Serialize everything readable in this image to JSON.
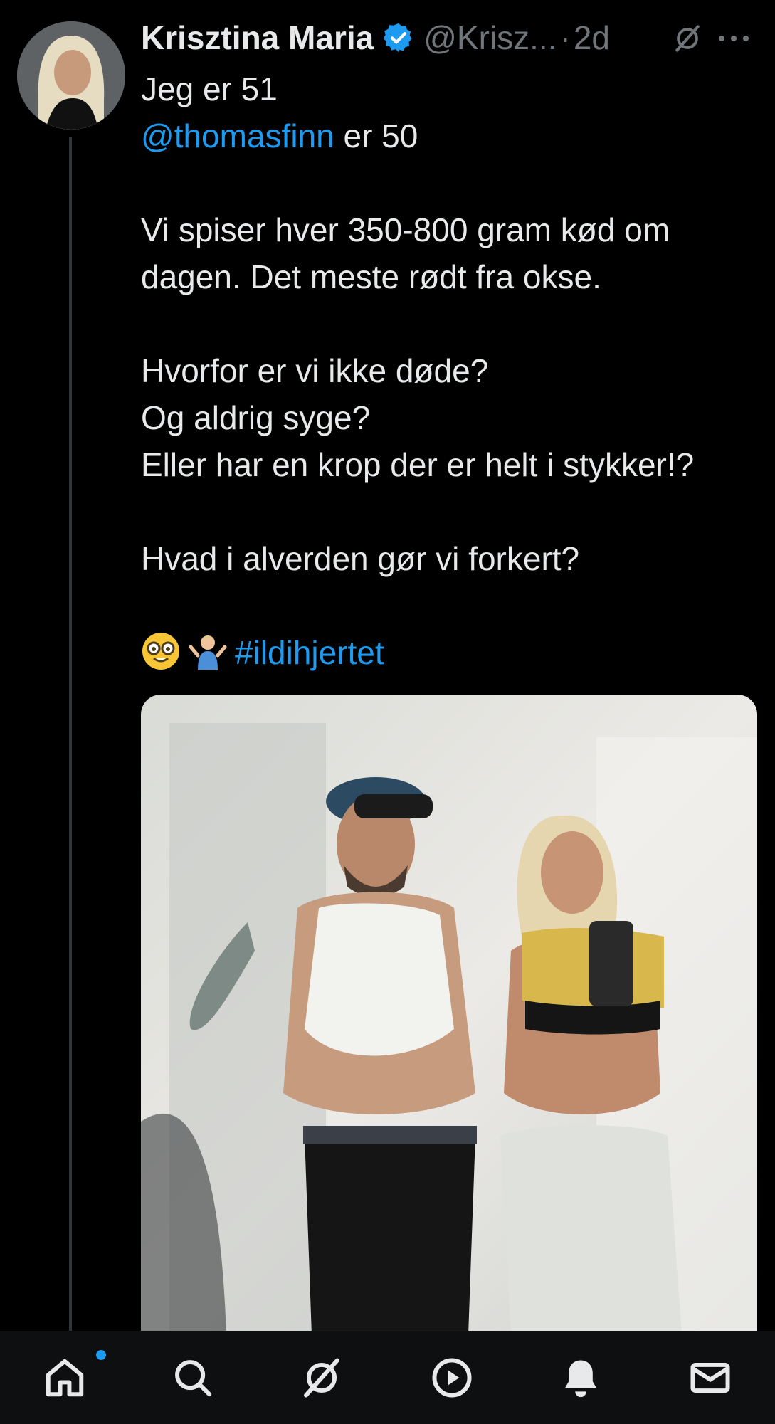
{
  "tweet": {
    "author_name": "Krisztina Maria",
    "handle": "@Krisz...",
    "separator": "·",
    "time": "2d",
    "lines": [
      {
        "text": "Jeg er 51"
      },
      {
        "mention": "@thomasfinn",
        "rest": " er 50"
      },
      {
        "text": ""
      },
      {
        "text": "Vi spiser hver 350-800 gram kød om"
      },
      {
        "text": "dagen. Det meste rødt fra okse."
      },
      {
        "text": ""
      },
      {
        "text": "Hvorfor er vi ikke døde?"
      },
      {
        "text": "Og aldrig syge?"
      },
      {
        "text": "Eller har en krop der er helt i stykker!?"
      },
      {
        "text": ""
      },
      {
        "text": "Hvad i alverden gør vi forkert?"
      },
      {
        "text": ""
      }
    ],
    "emojis": [
      "nerd-face-emoji",
      "shrug-emoji"
    ],
    "hashtag": "#ildihjertet"
  },
  "icons": {
    "verified": "verified-badge-icon",
    "grok": "grok-icon",
    "more": "more-icon"
  },
  "nav": {
    "items": [
      "home-icon",
      "search-icon",
      "grok-icon",
      "video-icon",
      "notifications-icon",
      "messages-icon"
    ],
    "active": "home",
    "has_notification_dot": true
  },
  "colors": {
    "background": "#000000",
    "text": "#e7e9ea",
    "secondary_text": "#71767b",
    "accent": "#1d9bf0"
  }
}
